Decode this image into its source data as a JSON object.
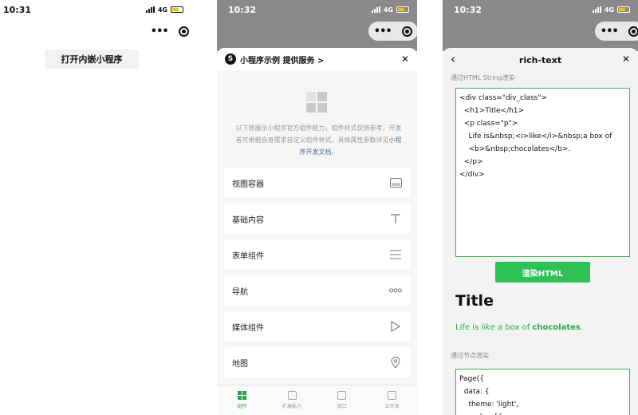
{
  "phone1": {
    "time": "10:31",
    "network": "4G",
    "open_button_label": "打开内嵌小程序"
  },
  "phone2": {
    "time": "10:32",
    "network": "4G",
    "header_title": "小程序示例 提供服务 >",
    "header_close": "✕",
    "intro_text": "以下将展示小程序官方组件能力，组件样式仅供参考，开发者可根据自身需求自定义组件样式，具体属性参数详见",
    "intro_link": "小程序开发文档",
    "intro_end": "。",
    "menu": [
      {
        "label": "视图容器",
        "icon": "view-container-icon"
      },
      {
        "label": "基础内容",
        "icon": "text-icon"
      },
      {
        "label": "表单组件",
        "icon": "form-icon"
      },
      {
        "label": "导航",
        "icon": "navigation-icon"
      },
      {
        "label": "媒体组件",
        "icon": "media-icon"
      },
      {
        "label": "地图",
        "icon": "map-pin-icon"
      }
    ],
    "tabs": [
      {
        "label": "组件",
        "active": true
      },
      {
        "label": "扩展能力",
        "active": false
      },
      {
        "label": "接口",
        "active": false
      },
      {
        "label": "云开发",
        "active": false
      }
    ],
    "accent_color": "#2aa845"
  },
  "phone3": {
    "time": "10:32",
    "network": "4G",
    "nav_title": "rich-text",
    "section1_label": "通过HTML String渲染",
    "html_code": "<div class=\"div_class\">\n  <h1>Title</h1>\n  <p class=\"p\">\n    Life is&nbsp;<i>like</i>&nbsp;a box of\n    <b>&nbsp;chocolates</b>.\n  </p>\n</div>",
    "render_button": "渲染HTML",
    "rendered_title": "Title",
    "rendered_line": {
      "before": "Life is ",
      "italic": "like",
      "middle": " a box of ",
      "bold": "chocolates",
      "after": "."
    },
    "section2_label": "通过节点渲染",
    "node_code": "Page({\n  data: {\n    theme: 'light',\n    nodes: [{",
    "button_color": "#2dc156"
  }
}
